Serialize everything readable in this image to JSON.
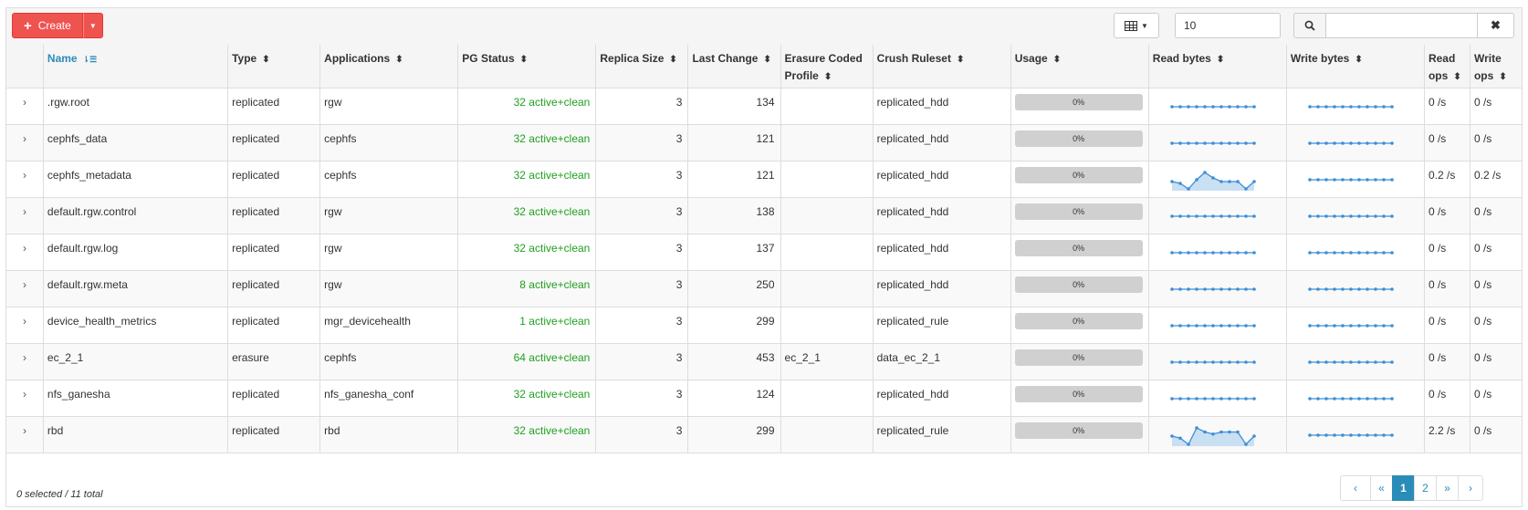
{
  "toolbar": {
    "create_label": "Create",
    "limit_value": "10",
    "search_value": ""
  },
  "columns": [
    {
      "label": "Name",
      "sort": "sorted"
    },
    {
      "label": "Type"
    },
    {
      "label": "Applications"
    },
    {
      "label": "PG Status"
    },
    {
      "label": "Replica Size"
    },
    {
      "label": "Last Change"
    },
    {
      "label": "Erasure Coded Profile"
    },
    {
      "label": "Crush Ruleset"
    },
    {
      "label": "Usage"
    },
    {
      "label": "Read bytes"
    },
    {
      "label": "Write bytes"
    },
    {
      "label": "Read ops"
    },
    {
      "label": "Write ops"
    }
  ],
  "rows": [
    {
      "name": ".rgw.root",
      "type": "replicated",
      "applications": "rgw",
      "pg_status": "32 active+clean",
      "replica_size": "3",
      "last_change": "134",
      "ec_profile": "",
      "crush_ruleset": "replicated_hdd",
      "usage": "0%",
      "read_bytes_trend": [
        0,
        0,
        0,
        0,
        0,
        0,
        0,
        0,
        0,
        0,
        0
      ],
      "write_bytes_trend": [
        0,
        0,
        0,
        0,
        0,
        0,
        0,
        0,
        0,
        0,
        0
      ],
      "read_ops": "0 /s",
      "write_ops": "0 /s"
    },
    {
      "name": "cephfs_data",
      "type": "replicated",
      "applications": "cephfs",
      "pg_status": "32 active+clean",
      "replica_size": "3",
      "last_change": "121",
      "ec_profile": "",
      "crush_ruleset": "replicated_hdd",
      "usage": "0%",
      "read_bytes_trend": [
        0,
        0,
        0,
        0,
        0,
        0,
        0,
        0,
        0,
        0,
        0
      ],
      "write_bytes_trend": [
        0,
        0,
        0,
        0,
        0,
        0,
        0,
        0,
        0,
        0,
        0
      ],
      "read_ops": "0 /s",
      "write_ops": "0 /s"
    },
    {
      "name": "cephfs_metadata",
      "type": "replicated",
      "applications": "cephfs",
      "pg_status": "32 active+clean",
      "replica_size": "3",
      "last_change": "121",
      "ec_profile": "",
      "crush_ruleset": "replicated_hdd",
      "usage": "0%",
      "read_bytes_trend": [
        4,
        3,
        0,
        5,
        9,
        6,
        4,
        4,
        4,
        0,
        4
      ],
      "write_bytes_trend": [
        0,
        0,
        0,
        0,
        0,
        0,
        0,
        0,
        0,
        0,
        0
      ],
      "read_ops": "0.2 /s",
      "write_ops": "0.2 /s"
    },
    {
      "name": "default.rgw.control",
      "type": "replicated",
      "applications": "rgw",
      "pg_status": "32 active+clean",
      "replica_size": "3",
      "last_change": "138",
      "ec_profile": "",
      "crush_ruleset": "replicated_hdd",
      "usage": "0%",
      "read_bytes_trend": [
        0,
        0,
        0,
        0,
        0,
        0,
        0,
        0,
        0,
        0,
        0
      ],
      "write_bytes_trend": [
        0,
        0,
        0,
        0,
        0,
        0,
        0,
        0,
        0,
        0,
        0
      ],
      "read_ops": "0 /s",
      "write_ops": "0 /s"
    },
    {
      "name": "default.rgw.log",
      "type": "replicated",
      "applications": "rgw",
      "pg_status": "32 active+clean",
      "replica_size": "3",
      "last_change": "137",
      "ec_profile": "",
      "crush_ruleset": "replicated_hdd",
      "usage": "0%",
      "read_bytes_trend": [
        0,
        0,
        0,
        0,
        0,
        0,
        0,
        0,
        0,
        0,
        0
      ],
      "write_bytes_trend": [
        0,
        0,
        0,
        0,
        0,
        0,
        0,
        0,
        0,
        0,
        0
      ],
      "read_ops": "0 /s",
      "write_ops": "0 /s"
    },
    {
      "name": "default.rgw.meta",
      "type": "replicated",
      "applications": "rgw",
      "pg_status": "8 active+clean",
      "replica_size": "3",
      "last_change": "250",
      "ec_profile": "",
      "crush_ruleset": "replicated_hdd",
      "usage": "0%",
      "read_bytes_trend": [
        0,
        0,
        0,
        0,
        0,
        0,
        0,
        0,
        0,
        0,
        0
      ],
      "write_bytes_trend": [
        0,
        0,
        0,
        0,
        0,
        0,
        0,
        0,
        0,
        0,
        0
      ],
      "read_ops": "0 /s",
      "write_ops": "0 /s"
    },
    {
      "name": "device_health_metrics",
      "type": "replicated",
      "applications": "mgr_devicehealth",
      "pg_status": "1 active+clean",
      "replica_size": "3",
      "last_change": "299",
      "ec_profile": "",
      "crush_ruleset": "replicated_rule",
      "usage": "0%",
      "read_bytes_trend": [
        0,
        0,
        0,
        0,
        0,
        0,
        0,
        0,
        0,
        0,
        0
      ],
      "write_bytes_trend": [
        0,
        0,
        0,
        0,
        0,
        0,
        0,
        0,
        0,
        0,
        0
      ],
      "read_ops": "0 /s",
      "write_ops": "0 /s"
    },
    {
      "name": "ec_2_1",
      "type": "erasure",
      "applications": "cephfs",
      "pg_status": "64 active+clean",
      "replica_size": "3",
      "last_change": "453",
      "ec_profile": "ec_2_1",
      "crush_ruleset": "data_ec_2_1",
      "usage": "0%",
      "read_bytes_trend": [
        0,
        0,
        0,
        0,
        0,
        0,
        0,
        0,
        0,
        0,
        0
      ],
      "write_bytes_trend": [
        0,
        0,
        0,
        0,
        0,
        0,
        0,
        0,
        0,
        0,
        0
      ],
      "read_ops": "0 /s",
      "write_ops": "0 /s"
    },
    {
      "name": "nfs_ganesha",
      "type": "replicated",
      "applications": "nfs_ganesha_conf",
      "pg_status": "32 active+clean",
      "replica_size": "3",
      "last_change": "124",
      "ec_profile": "",
      "crush_ruleset": "replicated_hdd",
      "usage": "0%",
      "read_bytes_trend": [
        0,
        0,
        0,
        0,
        0,
        0,
        0,
        0,
        0,
        0,
        0
      ],
      "write_bytes_trend": [
        0,
        0,
        0,
        0,
        0,
        0,
        0,
        0,
        0,
        0,
        0
      ],
      "read_ops": "0 /s",
      "write_ops": "0 /s"
    },
    {
      "name": "rbd",
      "type": "replicated",
      "applications": "rbd",
      "pg_status": "32 active+clean",
      "replica_size": "3",
      "last_change": "299",
      "ec_profile": "",
      "crush_ruleset": "replicated_rule",
      "usage": "0%",
      "read_bytes_trend": [
        4,
        3,
        0,
        8,
        6,
        5,
        6,
        6,
        6,
        0,
        4
      ],
      "write_bytes_trend": [
        0,
        0,
        0,
        0,
        0,
        0,
        0,
        0,
        0,
        0,
        0
      ],
      "read_ops": "2.2 /s",
      "write_ops": "0 /s"
    }
  ],
  "footer": {
    "selection_text": "0 selected / 11 total"
  },
  "pagination": {
    "prev_label": "‹",
    "first_label": "«",
    "pages": [
      "1",
      "2"
    ],
    "current_page": "1",
    "last_label": "»",
    "next_label": "›"
  },
  "colors": {
    "create_button": "#ef5350",
    "pg_status_ok": "#1fa01f",
    "accent": "#2a8cb9",
    "sparkline": "#3d8fd6"
  }
}
